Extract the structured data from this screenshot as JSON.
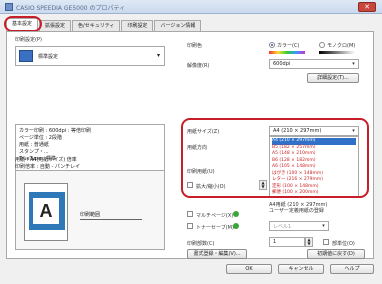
{
  "window": {
    "title": "CASIO SPEEDIA GE5000 のプロパティ"
  },
  "tabs": [
    "基本設定",
    "拡張設定",
    "色/セキュリティ",
    "印刷設定",
    "バージョン情報"
  ],
  "settings_select": {
    "label": "印刷設定(P)",
    "value": "標準設定"
  },
  "info_lines": [
    "カラー印刷   :  600dpi    :  等倍印刷",
    "ページ単位   :  2段階",
    "用紙        :  普通紙",
    "スタンプ・...",
    "TrueType    :  標準"
  ],
  "preview": {
    "line1": "用紙 :  A4(用紙サイズ)  倍率",
    "line2": "印刷倍率 : 自動 - パンチレイ",
    "sample_letter": "A",
    "print_layout_label": "印刷範囲"
  },
  "color": {
    "label": "印刷色",
    "options": [
      "カラー(C)",
      "モノクロ(M)"
    ],
    "selected": 0
  },
  "resolution": {
    "label": "解像度(R)",
    "value": "600dpi",
    "detail_button": "詳細設定(T)..."
  },
  "paper_size": {
    "label": "用紙サイズ(Z)",
    "value": "A4 (210 × 297mm)",
    "options": [
      "A4 (210 × 297mm)",
      "B5 (182 × 257mm)",
      "A5 (148 × 210mm)",
      "B6 (128 × 182mm)",
      "A6 (105 × 148mm)",
      "はがき (100 × 148mm)",
      "レター (216 × 279mm)",
      "定形 (100 × 148mm)",
      "郵便 (100 × 200mm)"
    ]
  },
  "paper_direction": {
    "label": "用紙方向"
  },
  "print_size": {
    "label": "印刷用紙(U)",
    "options_text": "A4用紙 (210 × 297mm)",
    "user_defined": "ユーザー定義用紙の登録"
  },
  "enlarge": {
    "label": "拡大/縮小(O)"
  },
  "multiple": {
    "label": "マルチページ(X)"
  },
  "toner_save": {
    "label": "トナーセーブ(M)",
    "value": "レベル1"
  },
  "copies": {
    "label": "印刷部数(C)",
    "value": "1",
    "collate_label": "部単位(O)"
  },
  "buttons": {
    "form_edit": "書式登録・編集(V)...",
    "restore": "初期値に戻す(D)",
    "ok": "OK",
    "cancel": "キャンセル",
    "help": "ヘルプ"
  }
}
